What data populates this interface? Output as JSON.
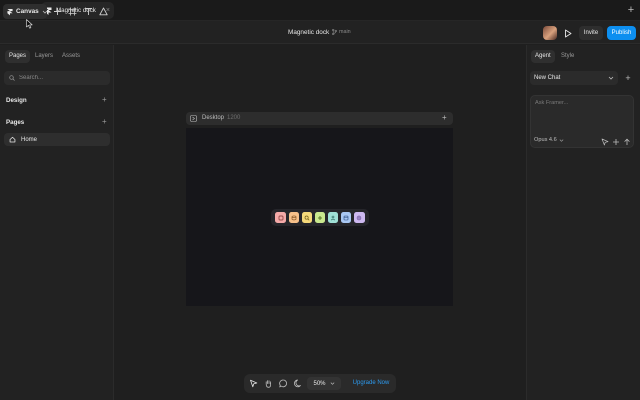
{
  "titlebar": {
    "doc_tab_title": "Magnetic dock",
    "tab_close": "×",
    "new_tab": "+"
  },
  "toolbar": {
    "canvas_menu_label": "Canvas",
    "project_title": "Magnetic dock",
    "branch_label": "main",
    "invite_label": "Invite",
    "publish_label": "Publish"
  },
  "left_panel": {
    "tabs": [
      {
        "label": "Pages",
        "active": true
      },
      {
        "label": "Layers",
        "active": false
      },
      {
        "label": "Assets",
        "active": false
      }
    ],
    "search_placeholder": "Search...",
    "sections": {
      "design_title": "Design",
      "pages_title": "Pages",
      "add": "+"
    },
    "pages": [
      {
        "label": "Home",
        "selected": true
      }
    ]
  },
  "canvas": {
    "frame_name": "Desktop",
    "frame_width": "1200",
    "frame_add": "+",
    "dock_items": [
      {
        "icon": "square-icon",
        "color": "#f4a9a8"
      },
      {
        "icon": "stack-icon",
        "color": "#f7c08a"
      },
      {
        "icon": "search-icon",
        "color": "#f5d97a"
      },
      {
        "icon": "plus-icon",
        "color": "#c9e88e"
      },
      {
        "icon": "person-icon",
        "color": "#9fe0d6"
      },
      {
        "icon": "window-icon",
        "color": "#a9c7f2"
      },
      {
        "icon": "gear-icon",
        "color": "#cdb8f0"
      }
    ]
  },
  "bottom_bar": {
    "zoom_level": "50%",
    "upgrade_label": "Upgrade Now"
  },
  "right_panel": {
    "tabs": [
      {
        "label": "Agent",
        "active": true
      },
      {
        "label": "Style",
        "active": false
      }
    ],
    "chat_select_label": "New Chat",
    "chat_add": "+",
    "prompt_placeholder": "Ask Framer...",
    "model_label": "Opus 4.6"
  },
  "colors": {
    "accent": "#0d8ff0",
    "upgrade_text": "#2d9bf0",
    "background": "#1f1f1f",
    "frame_bg": "#16161a"
  }
}
